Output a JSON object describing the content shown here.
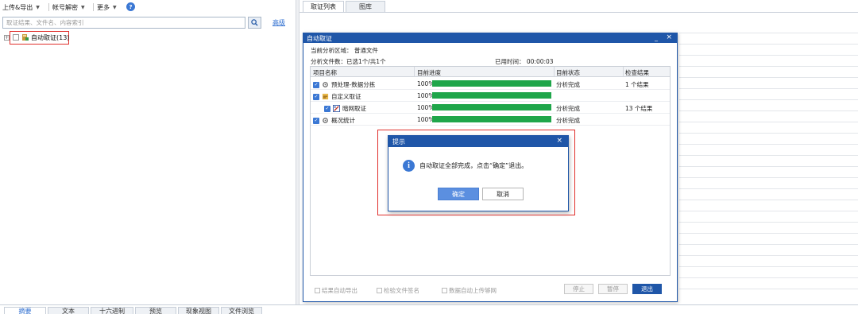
{
  "toolbar": {
    "upload_export": "上传&导出",
    "account_decrypt": "帐号解密",
    "more": "更多",
    "help": "?"
  },
  "search": {
    "placeholder": "取证结果、文件名、内容索引",
    "advanced": "高级"
  },
  "tree": {
    "root_label": "自动取证(13)"
  },
  "right_tabs": [
    "取证列表",
    "图库"
  ],
  "auto_dialog": {
    "title": "自动取证",
    "minimize": "_",
    "close": "×",
    "current_area": "当前分析区域：  普通文件",
    "file_count": "分析文件数：已选1个/共1个",
    "elapsed": "已用时间：  00:00:03",
    "columns": [
      "项目名称",
      "目前进度",
      "目前状态",
      "检查结果"
    ],
    "rows": [
      {
        "name": "预处理-数据分拣",
        "indent": false,
        "progress": 100,
        "progress_text": "100%",
        "status": "分析完成",
        "result": "1 个结果"
      },
      {
        "name": "自定义取证",
        "indent": false,
        "progress": 100,
        "progress_text": "100%",
        "status": "",
        "result": ""
      },
      {
        "name": "暗网取证",
        "indent": true,
        "progress": 100,
        "progress_text": "100%",
        "status": "分析完成",
        "result": "13 个结果"
      },
      {
        "name": "概况统计",
        "indent": false,
        "progress": 100,
        "progress_text": "100%",
        "status": "分析完成",
        "result": ""
      }
    ],
    "options": [
      "结果自动导出",
      "检验文件签名",
      "数据自动上传够网"
    ],
    "buttons": {
      "stop": "停止",
      "pause": "暂停",
      "exit": "退出"
    }
  },
  "prompt": {
    "title": "提示",
    "close": "×",
    "message": "自动取证全部完成，点击“确定”退出。",
    "ok": "确定",
    "cancel": "取消"
  },
  "bottom_tabs": [
    "摘要",
    "文本",
    "十六进制",
    "预览",
    "现象视图",
    "文件浏览"
  ],
  "colors": {
    "title_bar": "#1f56a8",
    "progress": "#1fa64a",
    "highlight": "#e0302c",
    "link": "#2f6fd0"
  }
}
